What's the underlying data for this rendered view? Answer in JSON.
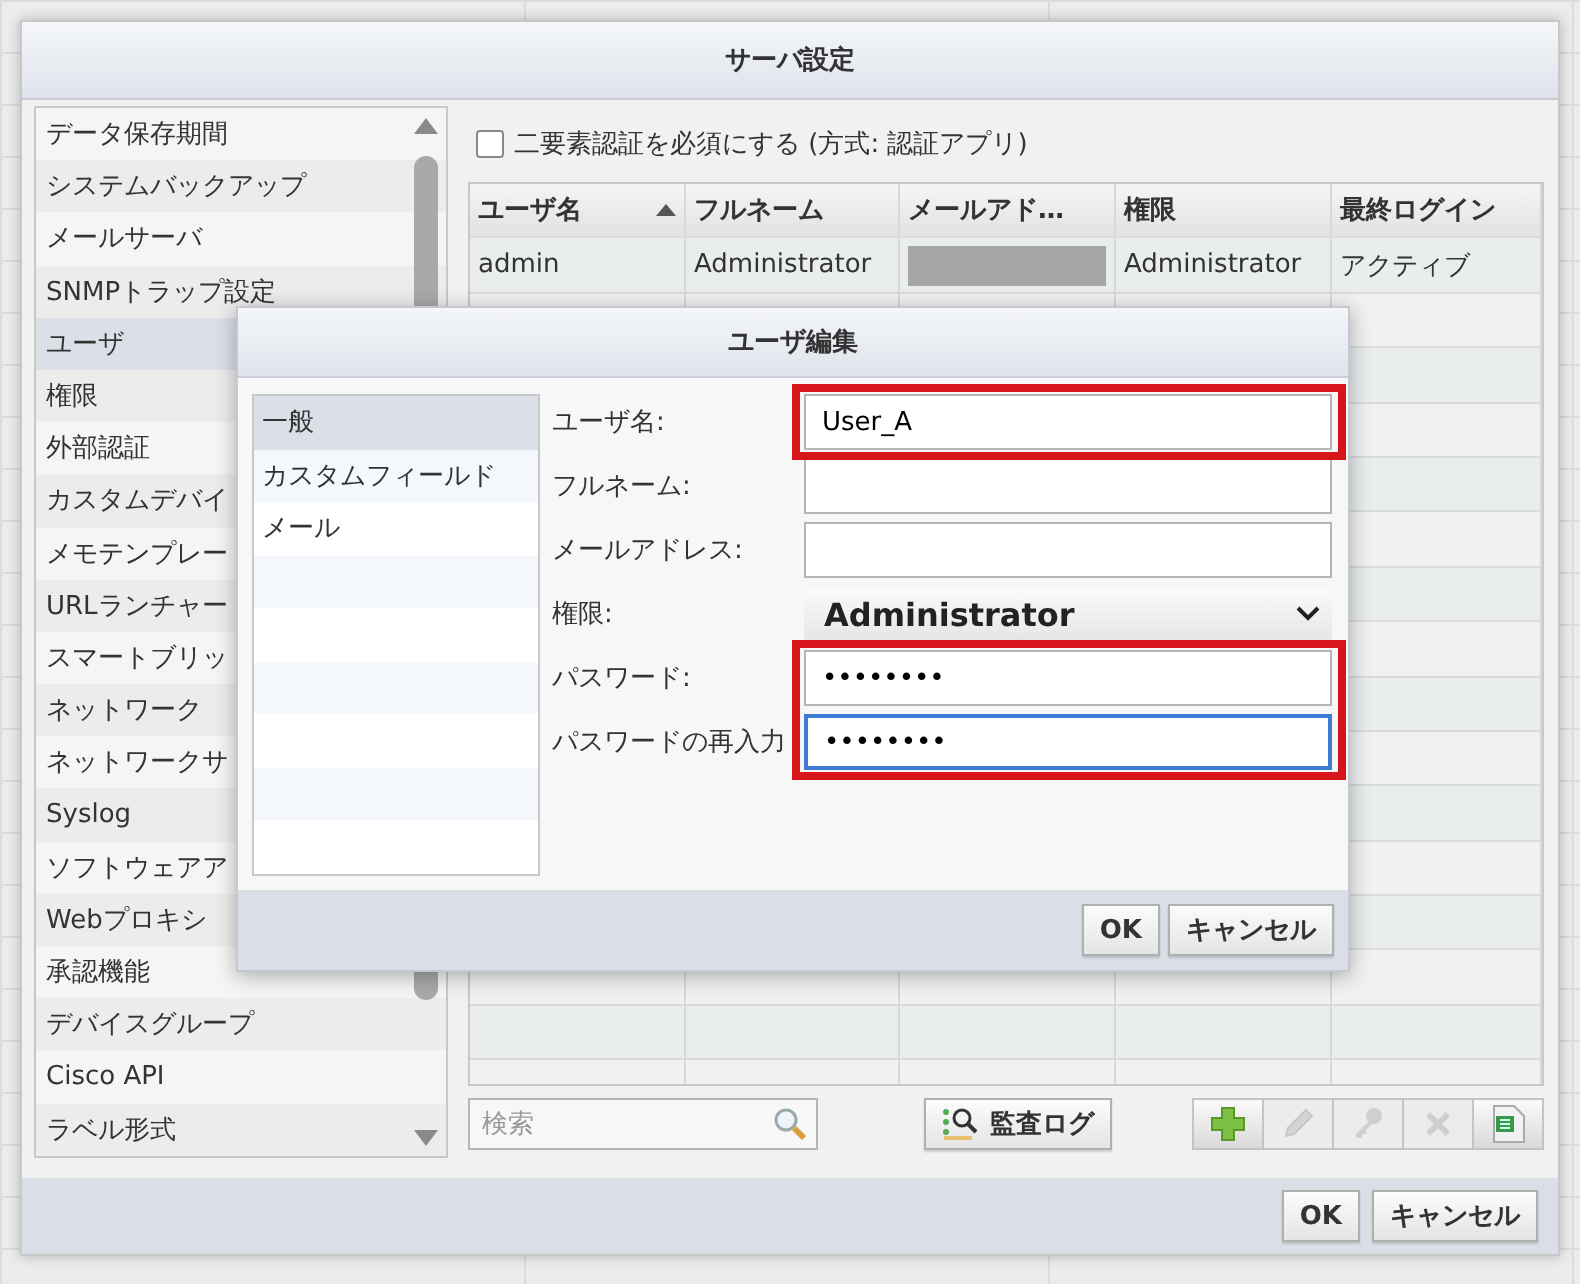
{
  "window": {
    "title": "サーバ設定"
  },
  "sidebar": {
    "items": [
      {
        "label": "データ保存期間",
        "selected": false
      },
      {
        "label": "システムバックアップ",
        "selected": false
      },
      {
        "label": "メールサーバ",
        "selected": false
      },
      {
        "label": "SNMPトラップ設定",
        "selected": false
      },
      {
        "label": "ユーザ",
        "selected": true
      },
      {
        "label": "権限",
        "selected": false
      },
      {
        "label": "外部認証",
        "selected": false
      },
      {
        "label": "カスタムデバイ",
        "selected": false
      },
      {
        "label": "メモテンプレー",
        "selected": false
      },
      {
        "label": "URLランチャー",
        "selected": false
      },
      {
        "label": "スマートブリッ",
        "selected": false
      },
      {
        "label": "ネットワーク",
        "selected": false
      },
      {
        "label": "ネットワークサ",
        "selected": false
      },
      {
        "label": "Syslog",
        "selected": false
      },
      {
        "label": "ソフトウェアア",
        "selected": false
      },
      {
        "label": "Webプロキシ",
        "selected": false
      },
      {
        "label": "承認機能",
        "selected": false
      },
      {
        "label": "デバイスグループ",
        "selected": false
      },
      {
        "label": "Cisco API",
        "selected": false
      },
      {
        "label": "ラベル形式",
        "selected": false
      }
    ]
  },
  "two_factor": {
    "label": "二要素認証を必須にする (方式: 認証アプリ)",
    "checked": false
  },
  "table": {
    "columns": [
      {
        "label": "ユーザ名",
        "sorted": true
      },
      {
        "label": "フルネーム",
        "sorted": false
      },
      {
        "label": "メールアド…",
        "sorted": false
      },
      {
        "label": "権限",
        "sorted": false
      },
      {
        "label": "最終ログイン",
        "sorted": false
      }
    ],
    "rows": [
      {
        "cells": [
          {
            "kind": "text",
            "text": "admin"
          },
          {
            "kind": "text",
            "text": "Administrator"
          },
          {
            "kind": "redacted"
          },
          {
            "kind": "text",
            "text": "Administrator"
          },
          {
            "kind": "text",
            "text": "アクティブ"
          }
        ]
      }
    ]
  },
  "search": {
    "placeholder": "検索"
  },
  "audit_button": "監査ログ",
  "tools": [
    {
      "kind": "add",
      "disabled": false
    },
    {
      "kind": "edit",
      "disabled": true
    },
    {
      "kind": "key",
      "disabled": true
    },
    {
      "kind": "delete",
      "disabled": true
    },
    {
      "kind": "export",
      "disabled": false
    }
  ],
  "buttons": [
    "OK",
    "キャンセル"
  ],
  "edit_dialog": {
    "title": "ユーザ編集",
    "tabs": [
      {
        "label": "一般",
        "selected": true
      },
      {
        "label": "カスタムフィールド",
        "selected": false
      },
      {
        "label": "メール",
        "selected": false
      }
    ],
    "fields": [
      {
        "kind": "text",
        "label": "ユーザ名:",
        "value": "User_A",
        "highlighted": true,
        "focused": false
      },
      {
        "kind": "text",
        "label": "フルネーム:",
        "highlighted": false,
        "focused": false
      },
      {
        "kind": "text",
        "label": "メールアドレス:",
        "highlighted": false,
        "focused": false
      },
      {
        "kind": "select",
        "label": "権限:",
        "value": "Administrator",
        "highlighted": false
      },
      {
        "kind": "text",
        "label": "パスワード:",
        "value": "••••••••",
        "highlighted": true,
        "focused": false
      },
      {
        "kind": "text",
        "label": "パスワードの再入力",
        "value": "••••••••",
        "highlighted": true,
        "focused": true
      }
    ],
    "buttons": [
      "OK",
      "キャンセル"
    ]
  }
}
